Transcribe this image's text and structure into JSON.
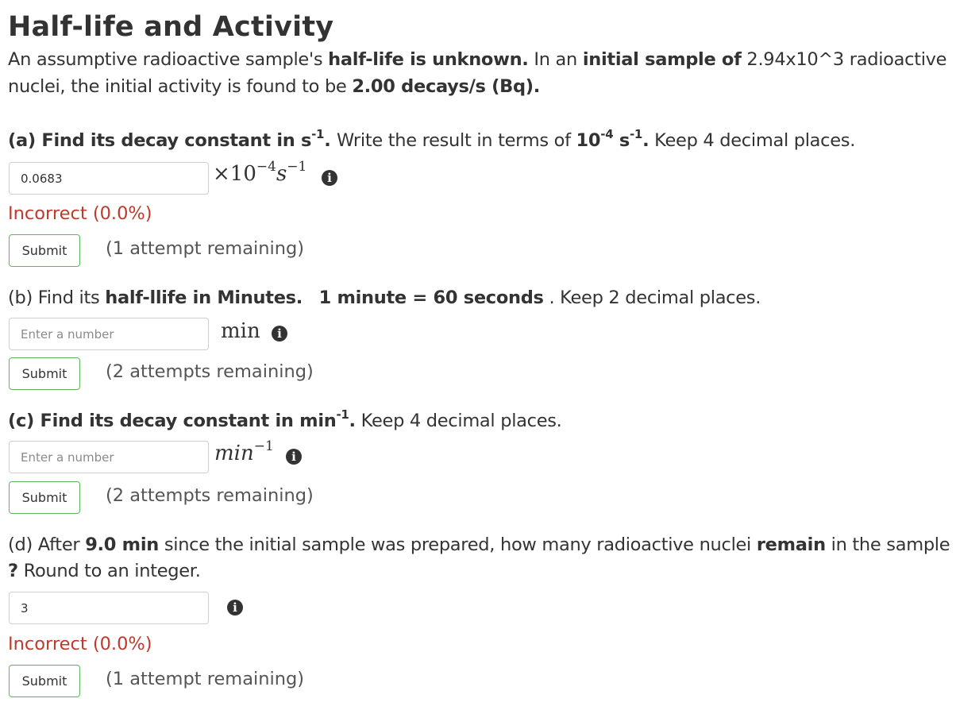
{
  "title": "Half-life and Activity",
  "intro": {
    "line1_a": "An assumptive radioactive sample's ",
    "line1_b": "half-life is unknown.",
    "line1_c": "  In an ",
    "line1_d": "initial sample of",
    "line1_e": " 2.94x10^3 radioactive",
    "line2_a": "nuclei, the initial activity is found to be ",
    "line2_b": "2.00 decays/s (Bq)."
  },
  "part_a": {
    "q1": "(a)  Find its decay constant in s",
    "q1_sup": "-1",
    "q2": ". ",
    "q3": "Write the result in terms of ",
    "q4": "10",
    "q4_sup": "-4",
    "q5": " s",
    "q5_sup": "-1",
    "q6": ".",
    "q7": " Keep 4 decimal places.",
    "value": "0.0683",
    "unit_main": "×10",
    "unit_exp": "−4",
    "unit_s": "s",
    "unit_s_exp": "−1",
    "feedback": "Incorrect (0.0%)",
    "submit": "Submit",
    "attempts": "(1 attempt remaining)"
  },
  "part_b": {
    "q1": "(b) Find its ",
    "q2": "half-llife in Minutes.",
    "q3": "   ",
    "q4": "1 minute = 60 seconds",
    "q5": " . Keep 2 decimal places.",
    "placeholder": "Enter a number",
    "unit": "min",
    "submit": "Submit",
    "attempts": "(2 attempts remaining)"
  },
  "part_c": {
    "q1": "(c) Find its decay constant in min",
    "q1_sup": "-1",
    "q2": ".",
    "q3": " Keep 4 decimal places.",
    "placeholder": "Enter a number",
    "unit": "min",
    "unit_exp": "−1",
    "submit": "Submit",
    "attempts": "(2 attempts remaining)"
  },
  "part_d": {
    "q1": "(d) After ",
    "q2": "9.0 min",
    "q3": " since the initial sample was prepared,  how many radioactive nuclei ",
    "q4": "remain",
    "q5": " in the sample",
    "q6": "?",
    "q7": " Round to an integer.",
    "value": "3",
    "feedback": "Incorrect (0.0%)",
    "submit": "Submit",
    "attempts": "(1 attempt remaining)"
  },
  "icons": {
    "info": "info-circle-icon"
  },
  "colors": {
    "accent_border": "#5cb85c",
    "incorrect": "#c0392b"
  }
}
